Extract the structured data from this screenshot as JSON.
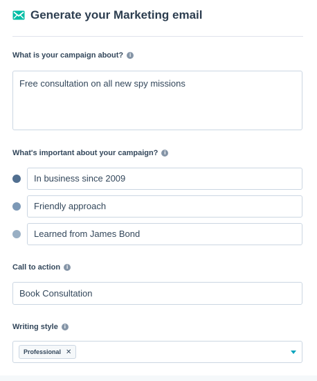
{
  "header": {
    "title": "Generate your Marketing email",
    "icon": "email-icon",
    "icon_color": "#00bda5"
  },
  "campaign_about": {
    "label": "What is your campaign about?",
    "value": "Free consultation on all new spy missions"
  },
  "important": {
    "label": "What's important about your campaign?",
    "items": [
      {
        "value": "In business since 2009",
        "dot_color": "#516f90"
      },
      {
        "value": "Friendly approach",
        "dot_color": "#7c98b6"
      },
      {
        "value": "Learned from James Bond",
        "dot_color": "#99afc4"
      }
    ]
  },
  "call_to_action": {
    "label": "Call to action",
    "value": "Book Consultation"
  },
  "writing_style": {
    "label": "Writing style",
    "selected_tag": "Professional",
    "remove_glyph": "✕"
  },
  "info_glyph": "i",
  "colors": {
    "text": "#33475b",
    "border": "#cbd6e2",
    "caret": "#00a4bd"
  }
}
